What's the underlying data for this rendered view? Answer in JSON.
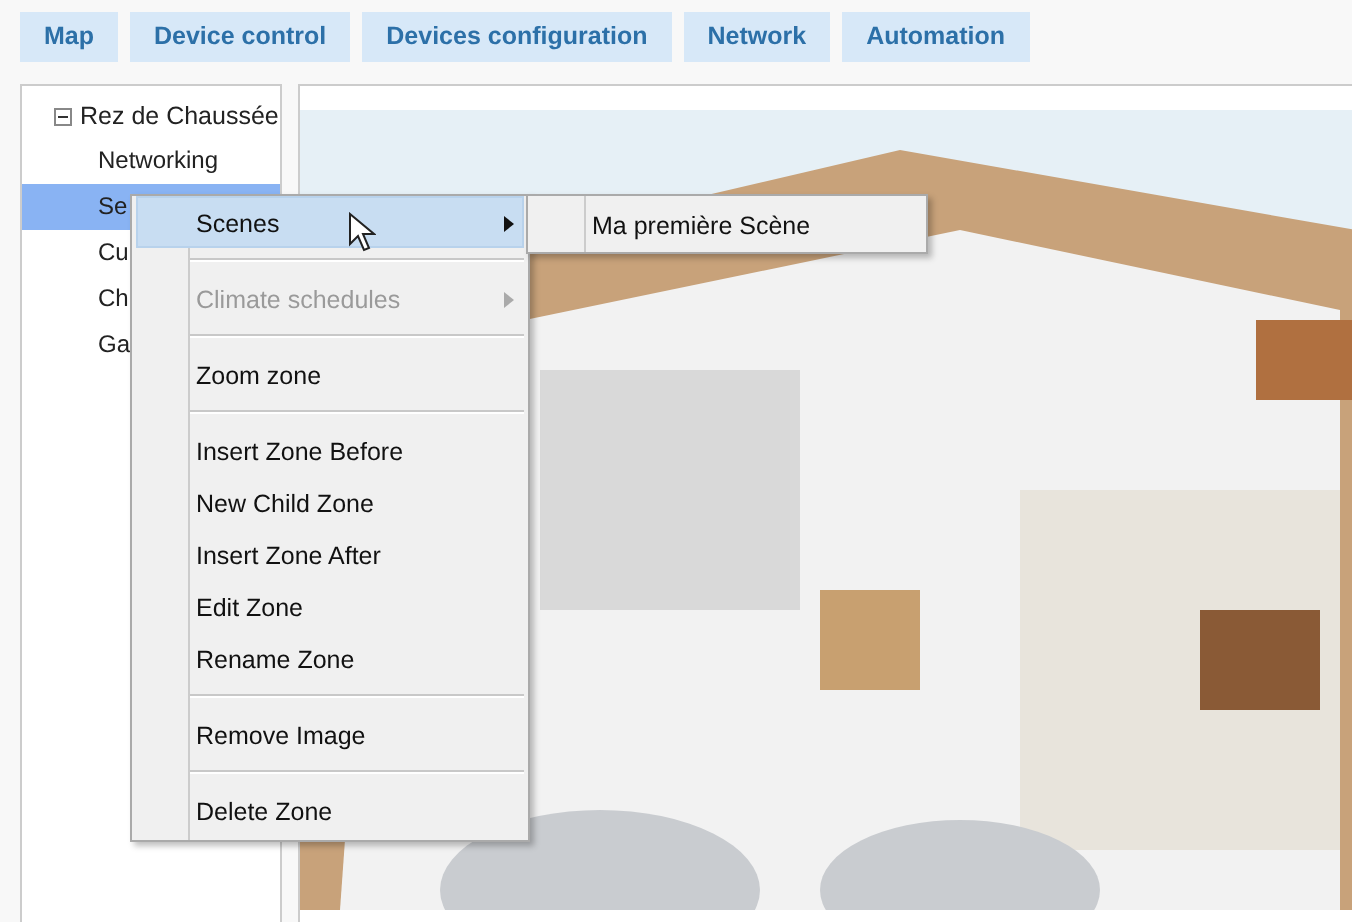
{
  "tabs": [
    {
      "label": "Map",
      "selected": false
    },
    {
      "label": "Device control",
      "selected": false
    },
    {
      "label": "Devices configuration",
      "selected": false
    },
    {
      "label": "Network",
      "selected": false
    },
    {
      "label": "Automation",
      "selected": false
    }
  ],
  "sidebar": {
    "tree": [
      {
        "label": "Rez de Chaussée",
        "expanded": true,
        "children": [
          {
            "label": "Networking",
            "selected": false
          },
          {
            "label": "Se",
            "selected": true
          },
          {
            "label": "Cu",
            "selected": false
          },
          {
            "label": "Ch",
            "selected": false
          },
          {
            "label": "Ga",
            "selected": false
          }
        ]
      }
    ]
  },
  "context_menu": {
    "sections": [
      {
        "items": [
          {
            "label": "Scenes",
            "submenu": true,
            "disabled": false,
            "highlighted": true
          }
        ]
      },
      {
        "items": [
          {
            "label": "Climate schedules",
            "submenu": true,
            "disabled": true,
            "highlighted": false
          }
        ]
      },
      {
        "items": [
          {
            "label": "Zoom zone",
            "submenu": false,
            "disabled": false,
            "highlighted": false
          }
        ]
      },
      {
        "items": [
          {
            "label": "Insert Zone Before",
            "submenu": false,
            "disabled": false,
            "highlighted": false
          },
          {
            "label": "New Child Zone",
            "submenu": false,
            "disabled": false,
            "highlighted": false
          },
          {
            "label": "Insert Zone After",
            "submenu": false,
            "disabled": false,
            "highlighted": false
          },
          {
            "label": "Edit Zone",
            "submenu": false,
            "disabled": false,
            "highlighted": false
          },
          {
            "label": "Rename Zone",
            "submenu": false,
            "disabled": false,
            "highlighted": false
          }
        ]
      },
      {
        "items": [
          {
            "label": "Remove Image",
            "submenu": false,
            "disabled": false,
            "highlighted": false
          }
        ]
      },
      {
        "items": [
          {
            "label": "Delete Zone",
            "submenu": false,
            "disabled": false,
            "highlighted": false
          }
        ]
      }
    ]
  },
  "submenu": {
    "items": [
      {
        "label": "Ma première Scène",
        "highlighted": false
      }
    ]
  }
}
